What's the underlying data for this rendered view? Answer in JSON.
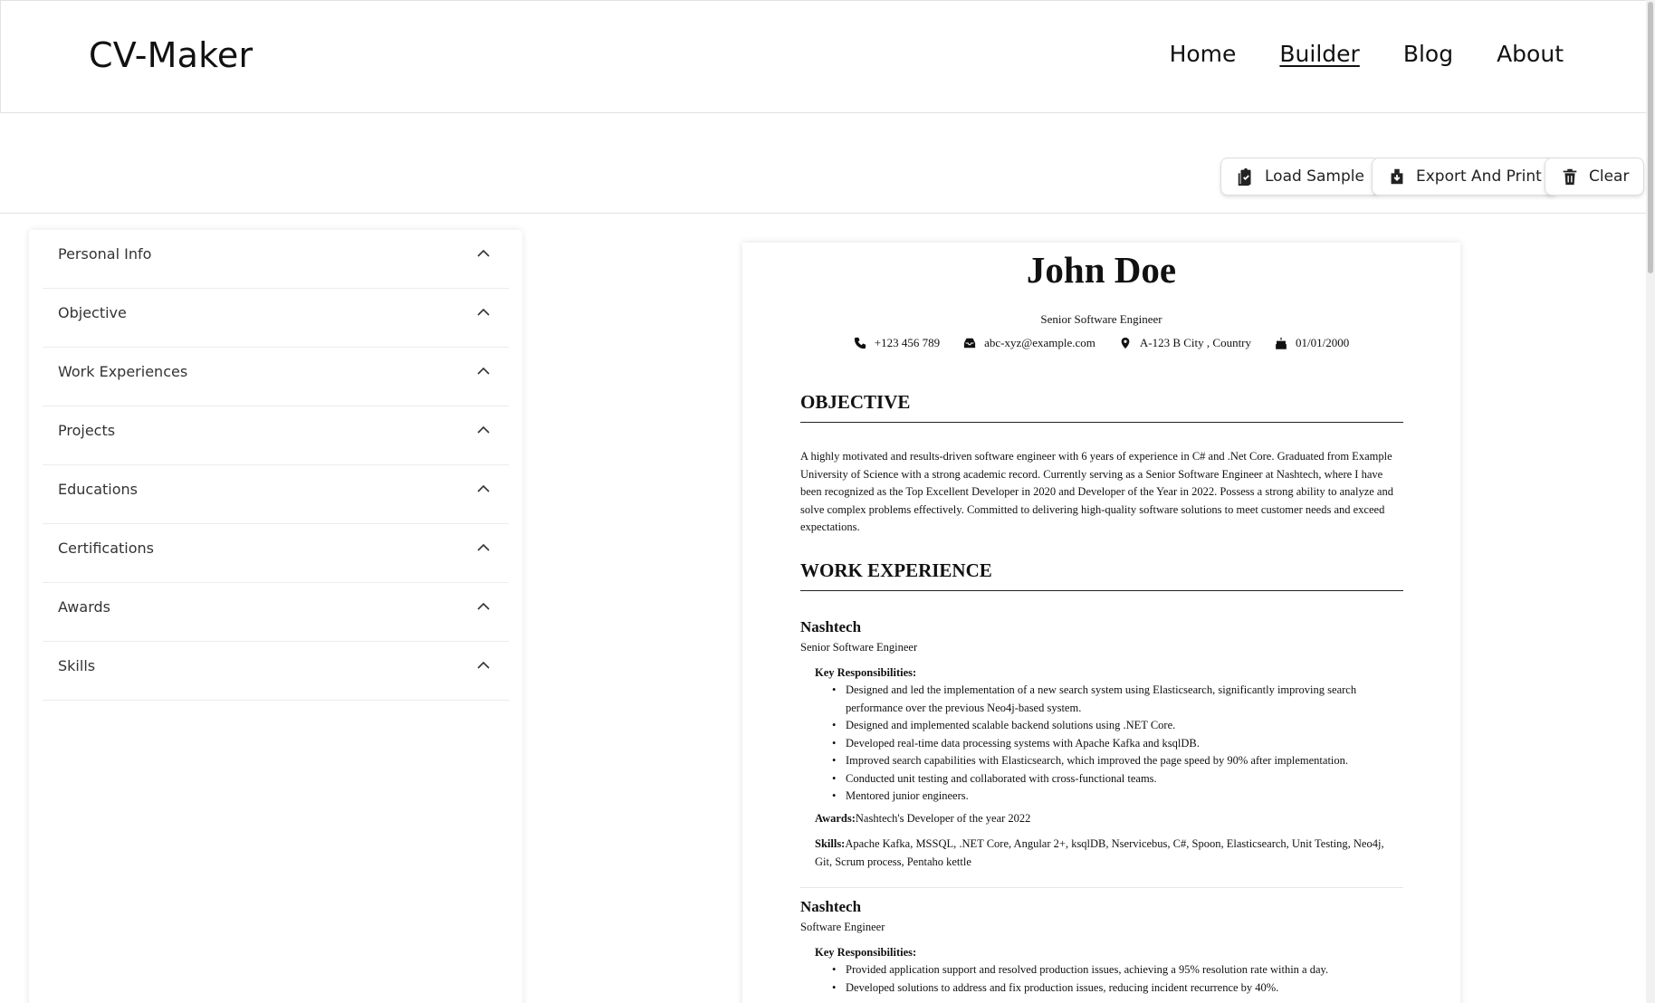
{
  "header": {
    "logo": "CV-Maker",
    "nav": [
      {
        "label": "Home",
        "active": false
      },
      {
        "label": "Builder",
        "active": true
      },
      {
        "label": "Blog",
        "active": false
      },
      {
        "label": "About",
        "active": false
      }
    ]
  },
  "toolbar": {
    "load_sample": "Load Sample",
    "export_print": "Export And Print",
    "clear": "Clear"
  },
  "sidebar": {
    "items": [
      {
        "label": "Personal Info"
      },
      {
        "label": "Objective"
      },
      {
        "label": "Work Experiences"
      },
      {
        "label": "Projects"
      },
      {
        "label": "Educations"
      },
      {
        "label": "Certifications"
      },
      {
        "label": "Awards"
      },
      {
        "label": "Skills"
      }
    ]
  },
  "resume": {
    "name": "John Doe",
    "title": "Senior Software Engineer",
    "contact": {
      "phone": "+123 456 789",
      "email": "abc-xyz@example.com",
      "address": "A-123 B City , Country",
      "dob": "01/01/2000"
    },
    "objective_heading": "OBJECTIVE",
    "objective_text": "A highly motivated and results-driven software engineer with 6 years of experience in C# and .Net Core. Graduated from Example University of Science with a strong academic record. Currently serving as a Senior Software Engineer at Nashtech, where I have been recognized as the Top Excellent Developer in 2020 and Developer of the Year in 2022. Possess a strong ability to analyze and solve complex problems effectively. Committed to delivering high-quality software solutions to meet customer needs and exceed expectations.",
    "work_heading": "WORK EXPERIENCE",
    "jobs": [
      {
        "company": "Nashtech",
        "role": "Senior Software Engineer",
        "kr_label": "Key Responsibilities:",
        "responsibilities": [
          "Designed and led the implementation of a new search system using Elasticsearch, significantly improving search performance over the previous Neo4j-based system.",
          "Designed and implemented scalable backend solutions using .NET Core.",
          "Developed real-time data processing systems with Apache Kafka and ksqlDB.",
          "Improved search capabilities with Elasticsearch, which improved the page speed by 90% after implementation.",
          "Conducted unit testing and collaborated with cross-functional teams.",
          "Mentored junior engineers."
        ],
        "awards_label": "Awards:",
        "awards": "Nashtech's Developer of the year 2022",
        "skills_label": "Skills:",
        "skills": "Apache Kafka, MSSQL, .NET Core, Angular 2+, ksqlDB, Nservicebus, C#, Spoon, Elasticsearch, Unit Testing, Neo4j, Git, Scrum process, Pentaho kettle"
      },
      {
        "company": "Nashtech",
        "role": "Software Engineer",
        "kr_label": "Key Responsibilities:",
        "responsibilities": [
          "Provided application support and resolved production issues, achieving a 95% resolution rate within a day.",
          "Developed solutions to address and fix production issues, reducing incident recurrence by 40%."
        ]
      }
    ]
  },
  "colors": {
    "border": "#e2e2e2",
    "text": "#111111"
  }
}
